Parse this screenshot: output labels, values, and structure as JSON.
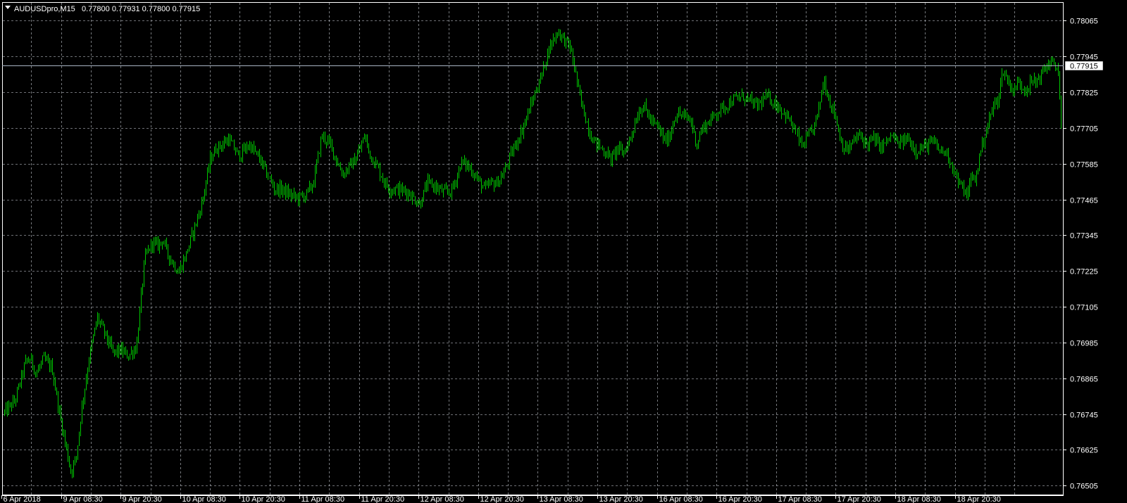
{
  "header": {
    "symbol": "AUDUSDpro,M15",
    "ohlc": "0.77800 0.77931 0.77800 0.77915"
  },
  "colors": {
    "background": "#000000",
    "bars": "#00c800",
    "grid": "#c4c8d0",
    "price_line": "#a8b4c4",
    "text": "#ffffff"
  },
  "icons": {
    "dropdown": "triangle-down-icon"
  },
  "chart_data": {
    "type": "bar",
    "series_name": "AUDUSDpro",
    "timeframe": "M15",
    "grid": true,
    "current_price": 0.77915,
    "current_price_label": "0.77915",
    "ylim": [
      0.76475,
      0.78125
    ],
    "y_ticks": [
      0.78065,
      0.77945,
      0.77825,
      0.77705,
      0.77585,
      0.77465,
      0.77345,
      0.77225,
      0.77105,
      0.76985,
      0.76865,
      0.76745,
      0.76625,
      0.76505
    ],
    "y_tick_labels": [
      "0.78065",
      "0.77945",
      "0.77825",
      "0.77705",
      "0.77585",
      "0.77465",
      "0.77345",
      "0.77225",
      "0.77105",
      "0.76985",
      "0.76865",
      "0.76745",
      "0.76625",
      "0.76505"
    ],
    "x_tick_labels": [
      "6 Apr 2018",
      "9 Apr 08:30",
      "9 Apr 20:30",
      "10 Apr 08:30",
      "10 Apr 20:30",
      "11 Apr 08:30",
      "11 Apr 20:30",
      "12 Apr 08:30",
      "12 Apr 20:30",
      "13 Apr 08:30",
      "13 Apr 20:30",
      "16 Apr 08:30",
      "16 Apr 20:30",
      "17 Apr 08:30",
      "17 Apr 20:30",
      "18 Apr 08:30",
      "18 Apr 20:30"
    ],
    "x_grid_count": 35,
    "trend_x": [
      0,
      0.01,
      0.02,
      0.025,
      0.03,
      0.037,
      0.045,
      0.052,
      0.058,
      0.063,
      0.068,
      0.073,
      0.08,
      0.088,
      0.097,
      0.103,
      0.11,
      0.117,
      0.125,
      0.133,
      0.14,
      0.145,
      0.15,
      0.155,
      0.16,
      0.165,
      0.172,
      0.18,
      0.187,
      0.195,
      0.201,
      0.207,
      0.212,
      0.222,
      0.232,
      0.242,
      0.25,
      0.255,
      0.262,
      0.27,
      0.277,
      0.285,
      0.292,
      0.3,
      0.308,
      0.316,
      0.32,
      0.332,
      0.341,
      0.345,
      0.352,
      0.36,
      0.365,
      0.372,
      0.382,
      0.387,
      0.393,
      0.4,
      0.407,
      0.415,
      0.422,
      0.426,
      0.432,
      0.438,
      0.445,
      0.45,
      0.455,
      0.46,
      0.466,
      0.472,
      0.48,
      0.49,
      0.5,
      0.51,
      0.514,
      0.519,
      0.524,
      0.53,
      0.535,
      0.54,
      0.545,
      0.55,
      0.555,
      0.561,
      0.567,
      0.575,
      0.58,
      0.585,
      0.59,
      0.595,
      0.6,
      0.605,
      0.612,
      0.62,
      0.625,
      0.63,
      0.635,
      0.64,
      0.65,
      0.655,
      0.66,
      0.668,
      0.675,
      0.683,
      0.69,
      0.7,
      0.712,
      0.722,
      0.732,
      0.742,
      0.75,
      0.755,
      0.759,
      0.765,
      0.77,
      0.775,
      0.781,
      0.786,
      0.79,
      0.795,
      0.8,
      0.805,
      0.81,
      0.816,
      0.822,
      0.83,
      0.84,
      0.845,
      0.85,
      0.855,
      0.862,
      0.87,
      0.878,
      0.885,
      0.892,
      0.899,
      0.903,
      0.907,
      0.911,
      0.915,
      0.919,
      0.923,
      0.93,
      0.936,
      0.94,
      0.945,
      0.95,
      0.955,
      0.96,
      0.964,
      0.968,
      0.972,
      0.976,
      0.982,
      0.988,
      0.991,
      0.994,
      0.997,
      1.0
    ],
    "trend_y": [
      0.7675,
      0.7679,
      0.7692,
      0.7693,
      0.7688,
      0.7693,
      0.769,
      0.7675,
      0.7664,
      0.7655,
      0.766,
      0.7676,
      0.7693,
      0.7707,
      0.77,
      0.7695,
      0.7696,
      0.7694,
      0.7697,
      0.7727,
      0.7732,
      0.7731,
      0.7733,
      0.7728,
      0.7725,
      0.7722,
      0.7728,
      0.7737,
      0.7745,
      0.776,
      0.7764,
      0.7765,
      0.7767,
      0.7761,
      0.7765,
      0.776,
      0.7754,
      0.775,
      0.775,
      0.7748,
      0.7747,
      0.7748,
      0.7752,
      0.7768,
      0.7765,
      0.7758,
      0.7755,
      0.776,
      0.7768,
      0.7762,
      0.7758,
      0.7752,
      0.775,
      0.775,
      0.7749,
      0.7747,
      0.7745,
      0.7752,
      0.7751,
      0.7749,
      0.7749,
      0.7752,
      0.7759,
      0.7758,
      0.7755,
      0.7752,
      0.775,
      0.7752,
      0.7752,
      0.7755,
      0.7762,
      0.777,
      0.778,
      0.779,
      0.7796,
      0.78,
      0.7803,
      0.78,
      0.7798,
      0.779,
      0.778,
      0.7774,
      0.7768,
      0.7765,
      0.7763,
      0.776,
      0.7764,
      0.7762,
      0.7765,
      0.777,
      0.7776,
      0.7778,
      0.7773,
      0.777,
      0.7766,
      0.7768,
      0.7775,
      0.7775,
      0.7773,
      0.7765,
      0.777,
      0.7773,
      0.7776,
      0.7778,
      0.778,
      0.7781,
      0.7778,
      0.7781,
      0.7778,
      0.7774,
      0.7768,
      0.7764,
      0.7767,
      0.777,
      0.7776,
      0.7787,
      0.7779,
      0.7775,
      0.7768,
      0.7763,
      0.7764,
      0.7767,
      0.7768,
      0.7765,
      0.7767,
      0.7764,
      0.7768,
      0.7765,
      0.7766,
      0.7767,
      0.7763,
      0.7764,
      0.7766,
      0.7763,
      0.7762,
      0.7756,
      0.7752,
      0.775,
      0.7748,
      0.7754,
      0.7753,
      0.7762,
      0.7771,
      0.7778,
      0.778,
      0.779,
      0.7786,
      0.7783,
      0.7786,
      0.7784,
      0.7784,
      0.7786,
      0.7786,
      0.7789,
      0.7792,
      0.7793,
      0.779,
      0.7792,
      0.7771,
      0.7791
    ]
  }
}
